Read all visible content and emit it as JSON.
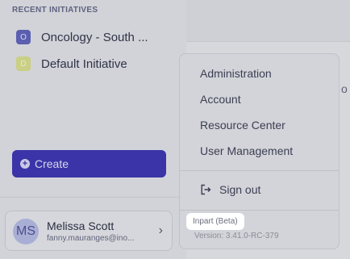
{
  "sidebar": {
    "section_title": "RECENT INITIATIVES",
    "initiatives": [
      {
        "badge": "O",
        "label": "Oncology - South ...",
        "badge_color": "#5b5fb0"
      },
      {
        "badge": "D",
        "label": "Default Initiative",
        "badge_color": "#c9cf84"
      }
    ],
    "create_label": "Create",
    "user": {
      "initials": "MS",
      "name": "Melissa Scott",
      "email": "fanny.mauranges@ino..."
    }
  },
  "background": {
    "partial_text": "o"
  },
  "menu": {
    "items": [
      {
        "label": "Administration"
      },
      {
        "label": "Account"
      },
      {
        "label": "Resource Center"
      },
      {
        "label": "User Management"
      }
    ],
    "signout_label": "Sign out",
    "product_tag": "Inpart (Beta)",
    "version": "Version: 3.41.0-RC-379"
  },
  "colors": {
    "accent": "#3a34a8",
    "overlay": "#d3d4d9"
  }
}
